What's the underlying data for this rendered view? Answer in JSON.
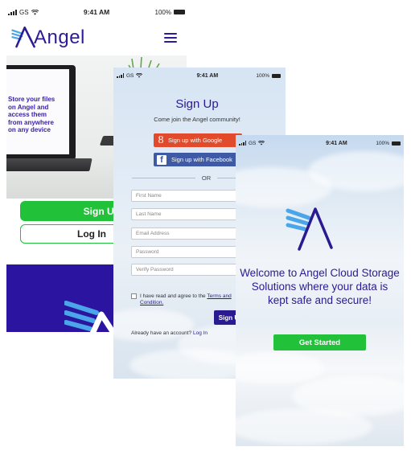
{
  "colors": {
    "brand_purple": "#2a1a92",
    "accent_green": "#22c13a",
    "google_red": "#e14a2a",
    "facebook_blue": "#3f5aa5",
    "logo_blue": "#4aa6e8"
  },
  "status_bar": {
    "carrier": "GS",
    "time": "9:41 AM",
    "battery": "100%"
  },
  "landing": {
    "brand": "Angel",
    "menu_icon": "hamburger-icon",
    "hero_lines": [
      "Store your files",
      "on Angel and",
      "access them",
      "from anywhere",
      "on any device"
    ],
    "signup_label": "Sign Up",
    "login_label": "Log In"
  },
  "signup": {
    "title": "Sign Up",
    "subtitle": "Come join the Angel community!",
    "google_label": "Sign up with Google",
    "facebook_label": "Sign up with Facebook",
    "or_label": "OR",
    "fields": {
      "first_name": "First Name",
      "last_name": "Last Name",
      "email": "Email Address",
      "password": "Password",
      "verify_password": "Verify Password"
    },
    "agree_prefix": "I have read and agree to the ",
    "agree_link_a": "Terms and",
    "agree_link_b": "Condition.",
    "submit_label": "Sign Up",
    "account_prompt": "Already have an account? ",
    "login_link": "Log In"
  },
  "welcome": {
    "message_lines": [
      "Welcome to Angel Cloud Storage",
      "Solutions where your data is",
      "kept safe and secure!"
    ],
    "cta_label": "Get Started"
  }
}
